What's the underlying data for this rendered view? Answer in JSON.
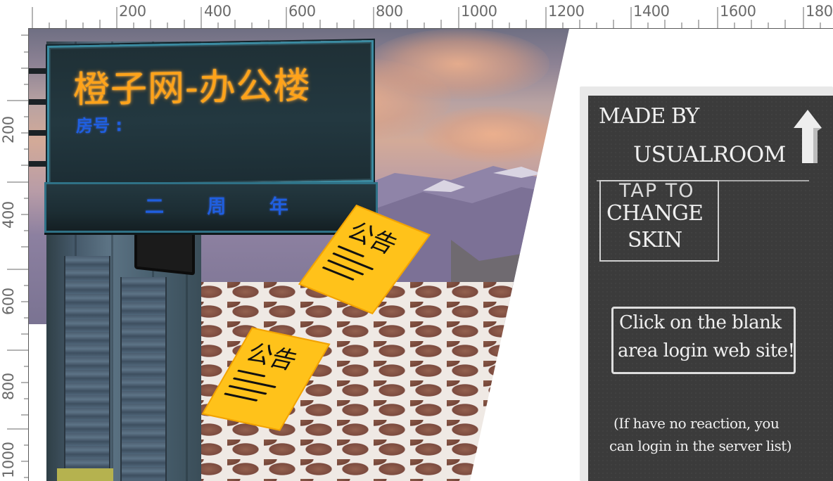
{
  "ruler": {
    "top_labels": [
      "200",
      "400",
      "600",
      "800",
      "1000",
      "1200",
      "1400",
      "1600",
      "180"
    ],
    "left_labels": [
      "200",
      "400",
      "600",
      "800",
      "1000"
    ]
  },
  "sign": {
    "title": "橙子网-办公楼",
    "room_label": "房号 :",
    "anniversary": "二 周 年"
  },
  "notices": [
    {
      "title": "公告"
    },
    {
      "title": "公告"
    }
  ],
  "chalkboard": {
    "made_by": "MADE BY",
    "author": "USUALROOM",
    "skin_button": {
      "line1": "TAP TO",
      "line2": "CHANGE",
      "line3": "SKIN"
    },
    "login_button": {
      "line1": "Click on the blank",
      "line2": "area login web site!"
    },
    "hint": {
      "line1": "(If have no reaction, you",
      "line2": "can login in the server list)"
    }
  },
  "colors": {
    "sign_title": "#ffa31a",
    "sign_blue": "#1f5fe0",
    "notice": "#ffc21a",
    "chalkboard": "#3b3b3b"
  }
}
